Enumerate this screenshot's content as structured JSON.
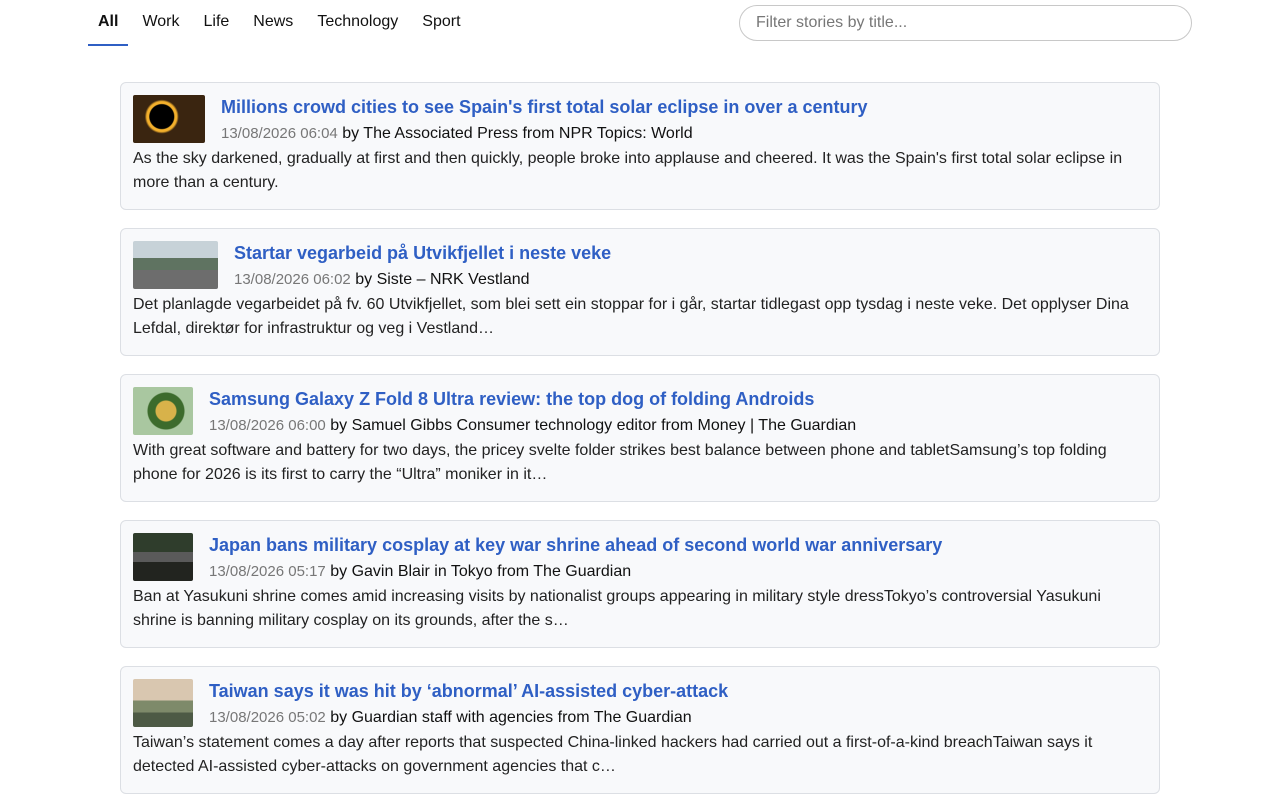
{
  "nav": {
    "tabs": [
      {
        "label": "All",
        "active": true
      },
      {
        "label": "Work"
      },
      {
        "label": "Life"
      },
      {
        "label": "News"
      },
      {
        "label": "Technology"
      },
      {
        "label": "Sport"
      }
    ]
  },
  "filter": {
    "placeholder": "Filter stories by title..."
  },
  "stories": [
    {
      "title": "Millions crowd cities to see Spain's first total solar eclipse in over a century",
      "timestamp": "13/08/2026 06:04",
      "byline": "by The Associated Press from NPR Topics: World",
      "summary": "As the sky darkened, gradually at first and then quickly, people broke into applause and cheered. It was the Spain's first total solar eclipse in more than a century.",
      "thumb": "eclipse-thumbnail"
    },
    {
      "title": "Startar vegarbeid på Utvikfjellet i neste veke",
      "timestamp": "13/08/2026 06:02",
      "byline": "by Siste – NRK Vestland",
      "summary": "Det planlagde vegarbeidet på fv. 60 Utvikfjellet, som blei sett ein stoppar for i går, startar tidlegast opp tysdag i neste veke. Det opplyser Dina Lefdal, direktør for infrastruktur og veg i Vestland…",
      "thumb": "road-thumbnail"
    },
    {
      "title": "Samsung Galaxy Z Fold 8 Ultra review: the top dog of folding Androids",
      "timestamp": "13/08/2026 06:00",
      "byline": "by Samuel Gibbs Consumer technology editor from Money | The Guardian",
      "summary": "With great software and battery for two days, the pricey svelte folder strikes best balance between phone and tabletSamsung’s top folding phone for 2026 is its first to carry the “Ultra” moniker in it…",
      "thumb": "phone-thumbnail"
    },
    {
      "title": "Japan bans military cosplay at key war shrine ahead of second world war anniversary",
      "timestamp": "13/08/2026 05:17",
      "byline": "by Gavin Blair in Tokyo from The Guardian",
      "summary": "Ban at Yasukuni shrine comes amid increasing visits by nationalist groups appearing in military style dressTokyo’s controversial Yasukuni shrine is banning military cosplay on its grounds, after the s…",
      "thumb": "shrine-thumbnail"
    },
    {
      "title": "Taiwan says it was hit by ‘abnormal’ AI-assisted cyber-attack",
      "timestamp": "13/08/2026 05:02",
      "byline": "by Guardian staff with agencies from The Guardian",
      "summary": "Taiwan’s statement comes a day after reports that suspected China-linked hackers had carried out a first-of-a-kind breachTaiwan says it detected AI-assisted cyber-attacks on government agencies that c…",
      "thumb": "city-thumbnail"
    }
  ]
}
